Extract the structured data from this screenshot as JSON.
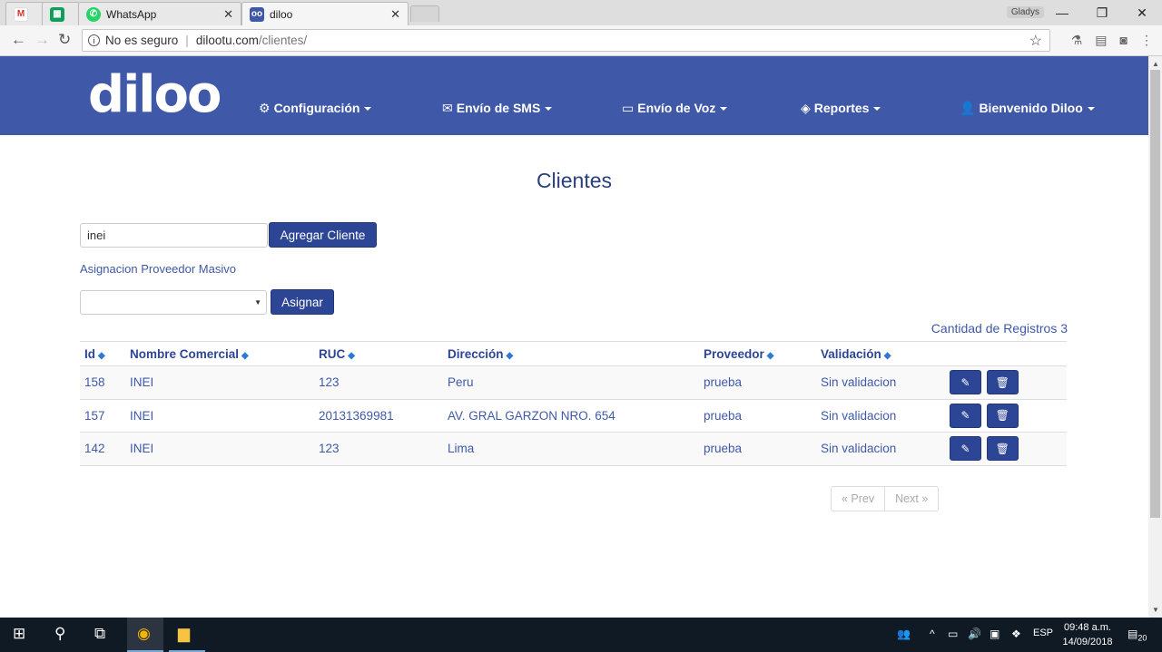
{
  "browser": {
    "tabs": [
      {
        "label": "",
        "icon": "gmail-icon"
      },
      {
        "label": "",
        "icon": "sheets-icon"
      },
      {
        "label": "WhatsApp",
        "icon": "whatsapp-icon"
      },
      {
        "label": "diloo",
        "icon": "diloo-icon"
      }
    ],
    "profile_name": "Gladys",
    "security_label": "No es seguro",
    "url_host": "dilootu.com",
    "url_path": "/clientes/"
  },
  "navbar": {
    "logo": "diloo",
    "items": [
      {
        "label": "Configuración",
        "icon": "gear-icon"
      },
      {
        "label": "Envío de SMS",
        "icon": "envelope-icon"
      },
      {
        "label": "Envío de Voz",
        "icon": "laptop-icon"
      },
      {
        "label": "Reportes",
        "icon": "cube-icon"
      },
      {
        "label": "Bienvenido Diloo",
        "icon": "user-icon"
      }
    ]
  },
  "page": {
    "title": "Clientes",
    "search_value": "inei",
    "add_button": "Agregar Cliente",
    "bulk_link": "Asignacion Proveedor Masivo",
    "select_value": "",
    "assign_button": "Asignar",
    "record_count_label": "Cantidad de Registros 3"
  },
  "table": {
    "headers": [
      "Id",
      "Nombre Comercial",
      "RUC",
      "Dirección",
      "Proveedor",
      "Validación"
    ],
    "rows": [
      {
        "id": "158",
        "nombre": "INEI",
        "ruc": "123",
        "direccion": "Peru",
        "proveedor": "prueba",
        "validacion": "Sin validacion"
      },
      {
        "id": "157",
        "nombre": "INEI",
        "ruc": "20131369981",
        "direccion": "AV. GRAL GARZON NRO. 654",
        "proveedor": "prueba",
        "validacion": "Sin validacion"
      },
      {
        "id": "142",
        "nombre": "INEI",
        "ruc": "123",
        "direccion": "Lima",
        "proveedor": "prueba",
        "validacion": "Sin validacion"
      }
    ]
  },
  "pager": {
    "prev": "« Prev",
    "next": "Next »"
  },
  "taskbar": {
    "language": "ESP",
    "time": "09:48 a.m.",
    "date": "14/09/2018",
    "notifications": "20"
  },
  "colors": {
    "navbar": "#3f59a8",
    "primary_button": "#2d4595",
    "title": "#2a3f7d"
  }
}
